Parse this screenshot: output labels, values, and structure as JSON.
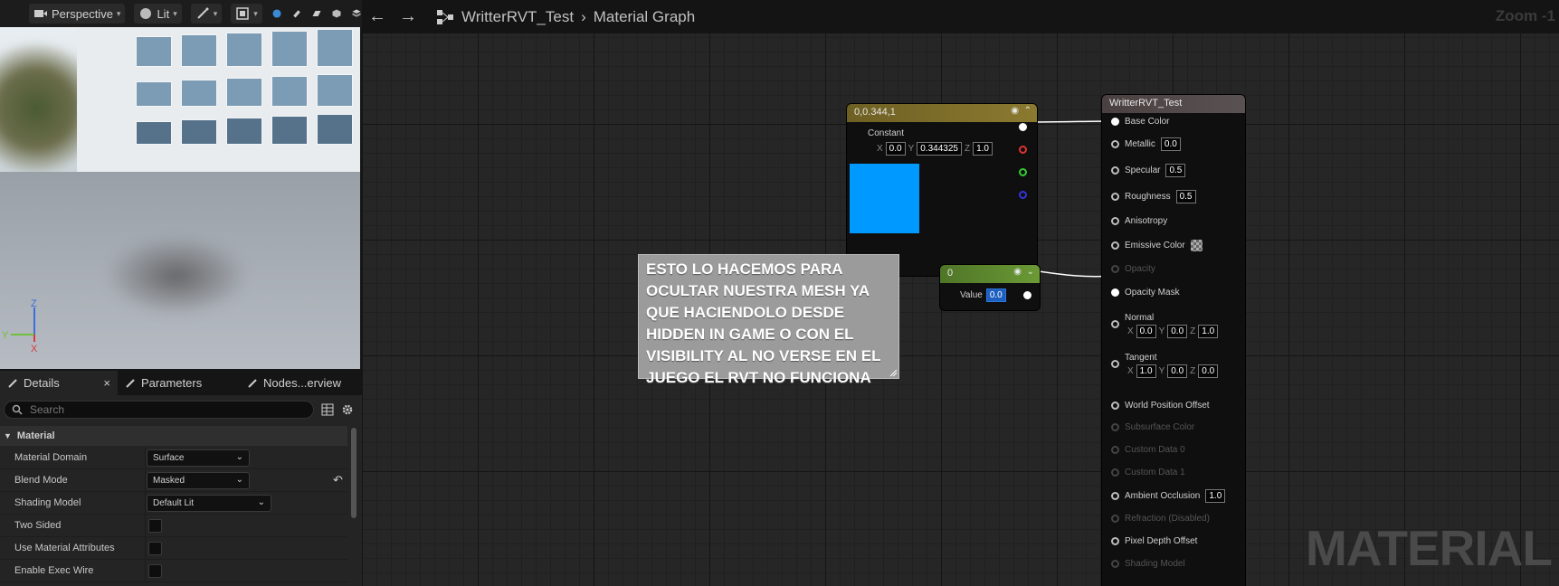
{
  "viewport": {
    "toolbar": {
      "view_mode": "Perspective",
      "lighting": "Lit"
    },
    "axes": {
      "x": "X",
      "y": "Y",
      "z": "Z"
    }
  },
  "panel_tabs": [
    {
      "label": "Details",
      "close": "×"
    },
    {
      "label": "Parameters"
    },
    {
      "label": "Nodes...erview"
    }
  ],
  "details": {
    "search_placeholder": "Search",
    "category": "Material",
    "rows": [
      {
        "label": "Material Domain",
        "value": "Surface"
      },
      {
        "label": "Blend Mode",
        "value": "Masked"
      },
      {
        "label": "Shading Model",
        "value": "Default Lit"
      },
      {
        "label": "Two Sided"
      },
      {
        "label": "Use Material Attributes"
      },
      {
        "label": "Enable Exec Wire"
      }
    ]
  },
  "graph": {
    "breadcrumb": [
      "WritterRVT_Test",
      "Material Graph"
    ],
    "zoom": "Zoom -1",
    "watermark": "MATERIAL",
    "constant_node": {
      "title": "0,0.344,1",
      "label": "Constant",
      "x_label": "X",
      "x": "0.0",
      "y_label": "Y",
      "y": "0.344325",
      "z_label": "Z",
      "z": "1.0",
      "preview_color": "#0099ff"
    },
    "scalar_node": {
      "title": "0",
      "label": "Value",
      "value": "0.0"
    },
    "comment": "ESTO LO HACEMOS PARA OCULTAR NUESTRA MESH YA QUE HACIENDOLO DESDE HIDDEN IN GAME O CON EL VISIBILITY AL NO VERSE EN EL JUEGO EL RVT NO FUNCIONA",
    "material_node": {
      "title": "WritterRVT_Test",
      "inputs": {
        "base_color": "Base Color",
        "metallic": "Metallic",
        "metallic_value": "0.0",
        "specular": "Specular",
        "specular_value": "0.5",
        "roughness": "Roughness",
        "roughness_value": "0.5",
        "anisotropy": "Anisotropy",
        "emissive": "Emissive Color",
        "opacity": "Opacity",
        "opacity_mask": "Opacity Mask",
        "normal": "Normal",
        "normal_x": "0.0",
        "normal_y": "0.0",
        "normal_z": "1.0",
        "tangent": "Tangent",
        "tangent_x": "1.0",
        "tangent_y": "0.0",
        "tangent_z": "0.0",
        "wpo": "World Position Offset",
        "subsurface": "Subsurface Color",
        "custom0": "Custom Data 0",
        "custom1": "Custom Data 1",
        "ao": "Ambient Occlusion",
        "ao_value": "1.0",
        "refraction": "Refraction (Disabled)",
        "pdo": "Pixel Depth Offset",
        "shading_model": "Shading Model"
      }
    }
  }
}
